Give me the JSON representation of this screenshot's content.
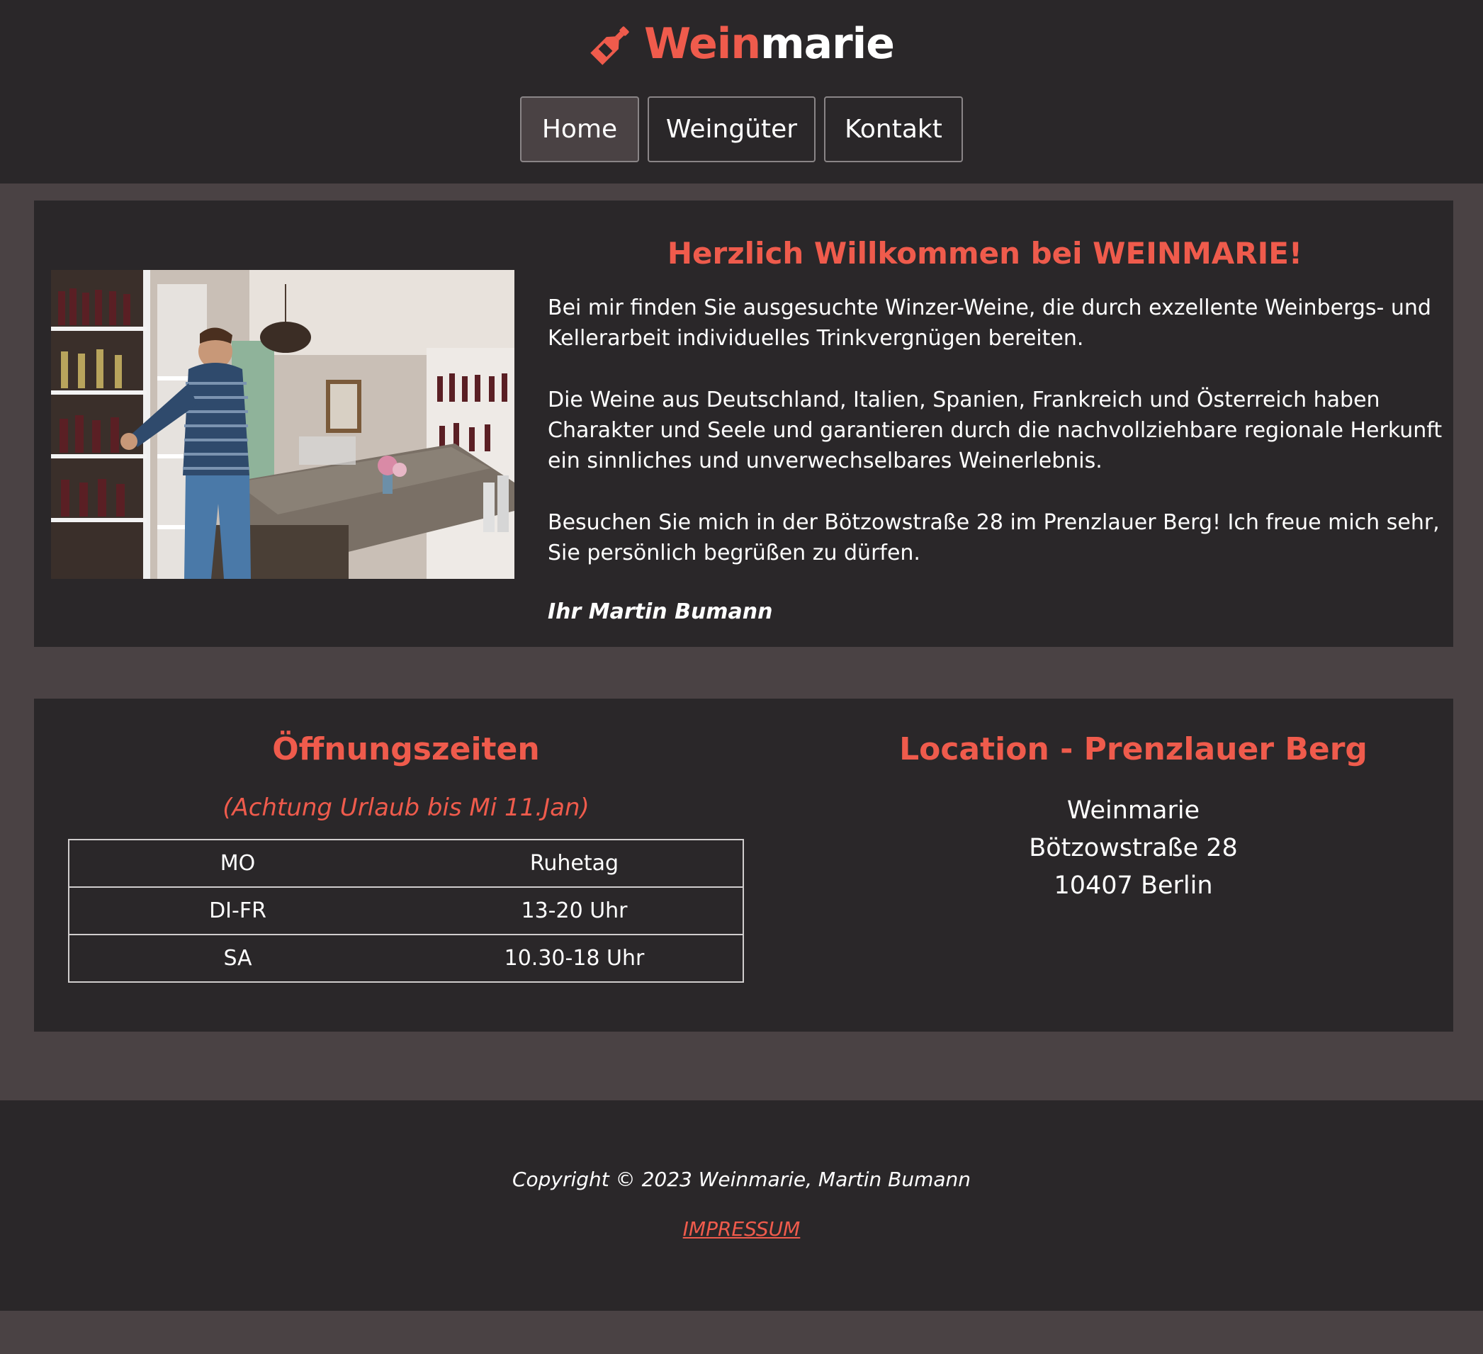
{
  "brand": {
    "name_part1": "Wein",
    "name_part2": "marie",
    "icon": "wine-bottle-icon",
    "accent_color": "#ef5b4c"
  },
  "nav": {
    "items": [
      {
        "label": "Home",
        "active": true
      },
      {
        "label": "Weingüter",
        "active": false
      },
      {
        "label": "Kontakt",
        "active": false
      }
    ]
  },
  "welcome": {
    "title": "Herzlich Willkommen bei WEINMARIE!",
    "paragraphs": [
      "Bei mir finden Sie ausgesuchte Winzer-Weine, die durch exzellente Weinbergs- und Kellerarbeit individuelles Trinkvergnügen bereiten.",
      "Die Weine aus Deutschland, Italien, Spanien, Frankreich und Österreich haben Charakter und Seele und garantieren durch die nachvollziehbare regionale Herkunft ein sinnliches und unverwechselbares Weinerlebnis.",
      "Besuchen Sie mich in der Bötzowstraße 28 im Prenzlauer Berg! Ich freue mich sehr, Sie persönlich begrüßen zu dürfen."
    ],
    "signature": "Ihr Martin Bumann"
  },
  "hours": {
    "title": "Öffnungszeiten",
    "note": "(Achtung Urlaub bis Mi 11.Jan)",
    "rows": [
      {
        "day": "MO",
        "time": "Ruhetag"
      },
      {
        "day": "DI-FR",
        "time": "13-20 Uhr"
      },
      {
        "day": "SA",
        "time": "10.30-18 Uhr"
      }
    ]
  },
  "location": {
    "title": "Location - Prenzlauer Berg",
    "address": [
      "Weinmarie",
      "Bötzowstraße 28",
      "10407 Berlin"
    ]
  },
  "footer": {
    "copyright": "Copyright © 2023 Weinmarie, Martin Bumann",
    "impressum": "IMPRESSUM"
  }
}
